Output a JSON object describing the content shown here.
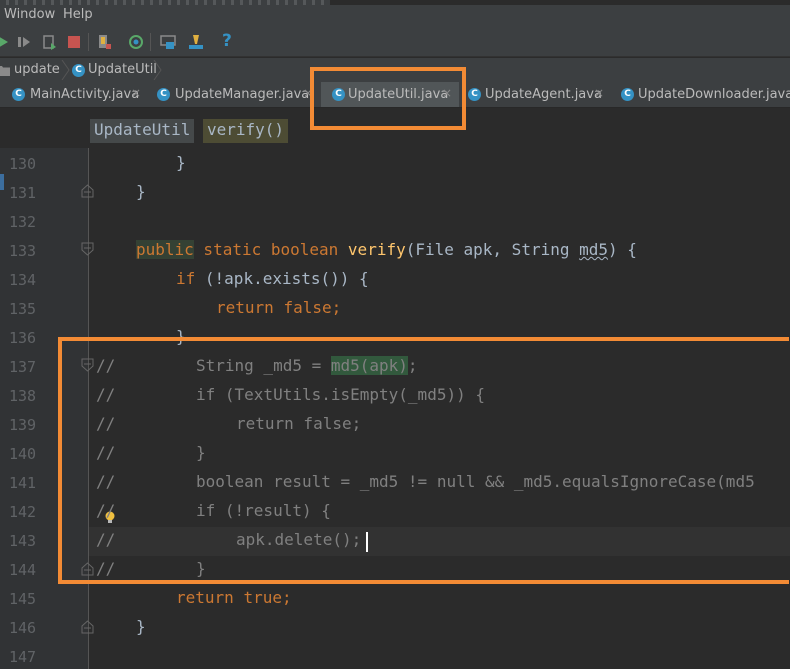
{
  "menubar": {
    "window": "Window",
    "help": "Help"
  },
  "toolbar": {
    "help_glyph": "?"
  },
  "breadcrumb": [
    {
      "label": "update"
    },
    {
      "label": "UpdateUtil"
    }
  ],
  "tabs": [
    {
      "label": "MainActivity.java",
      "close": "×",
      "active": false
    },
    {
      "label": "UpdateManager.java",
      "close": "×",
      "active": false
    },
    {
      "label": "UpdateUtil.java",
      "close": "×",
      "active": true
    },
    {
      "label": "UpdateAgent.java",
      "close": "×",
      "active": false
    },
    {
      "label": "UpdateDownloader.java",
      "close": "×",
      "active": false
    }
  ],
  "class_icon_letter": "C",
  "structure": {
    "class_name": "UpdateUtil",
    "method_name": "verify()"
  },
  "line_numbers": [
    "130",
    "131",
    "132",
    "133",
    "134",
    "135",
    "136",
    "137",
    "138",
    "139",
    "140",
    "141",
    "142",
    "143",
    "144",
    "145",
    "146",
    "147"
  ],
  "code": {
    "l130": "}",
    "l131": "}",
    "l133_public": "public",
    "l133_static": " static ",
    "l133_boolean": "boolean ",
    "l133_verify": "verify",
    "l133_rest1": "(File apk, String ",
    "l133_md5": "md5",
    "l133_rest2": ") {",
    "l134_if": "if ",
    "l134_rest": "(!apk.exists()) {",
    "l135_return": "return ",
    "l135_false": "false",
    "l135_semi": ";",
    "l136": "}",
    "l137_pre": "String _md5 = ",
    "l137_call": "md5(apk)",
    "l137_semi": ";",
    "l138": "if (TextUtils.isEmpty(_md5)) {",
    "l139": "return false;",
    "l140": "}",
    "l141": "boolean result = _md5 != null && _md5.equalsIgnoreCase(md5",
    "l142": "if (!result) {",
    "l143": "apk.delete();",
    "l144": "}",
    "l145_return": "return ",
    "l145_true": "true",
    "l145_semi": ";",
    "l146": "}",
    "comment_marker": "//"
  },
  "colors": {
    "annotation": "#f38b35",
    "keyword": "#cc7832",
    "method": "#ffc66d",
    "comment": "#808080",
    "text": "#a9b7c6",
    "class_icon": "#3592c4"
  }
}
